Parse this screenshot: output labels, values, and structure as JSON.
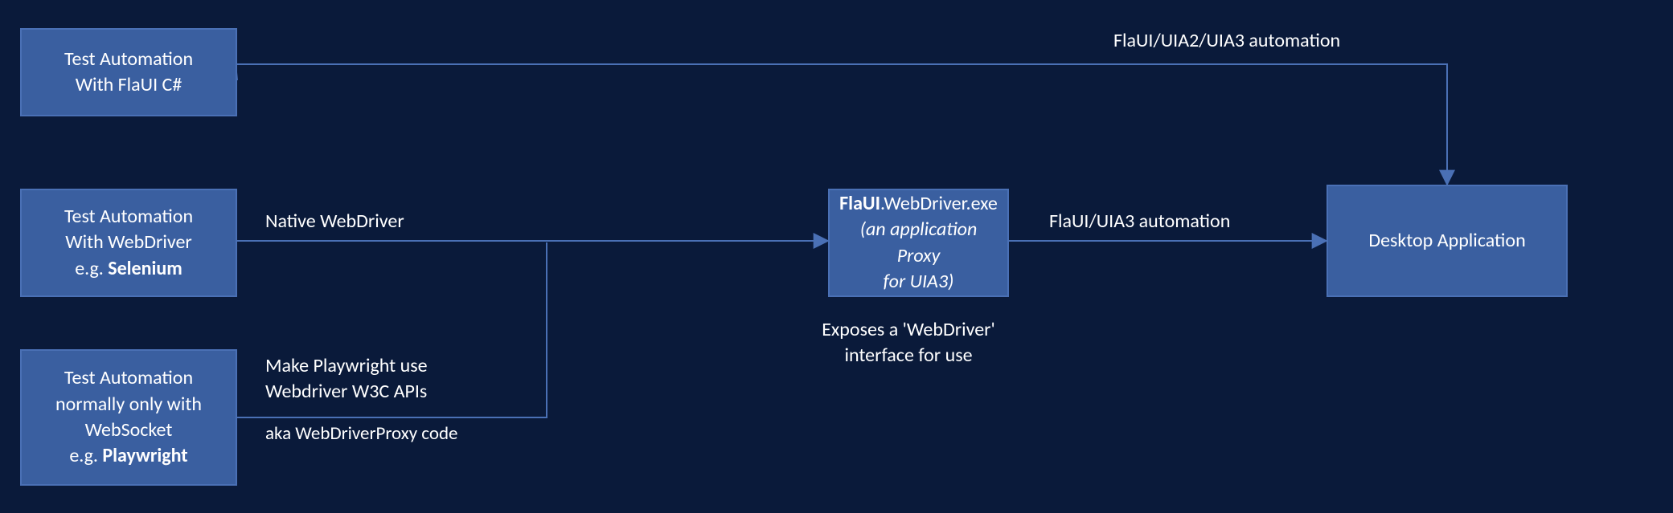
{
  "boxes": {
    "flaui_csharp": {
      "line1": "Test Automation",
      "line2": "With FlaUI C#"
    },
    "selenium": {
      "line1": "Test Automation",
      "line2": "With WebDriver",
      "line3_prefix": "e.g. ",
      "line3_bold": "Selenium"
    },
    "playwright": {
      "line1": "Test Automation",
      "line2": "normally only with",
      "line3": "WebSocket",
      "line4_prefix": "e.g. ",
      "line4_bold": "Playwright"
    },
    "proxy": {
      "line1_bold": "FlaUI",
      "line1_rest": ".WebDriver.exe",
      "line2": "(an application Proxy",
      "line3": "for UIA3)"
    },
    "desktop": {
      "text": "Desktop Application"
    }
  },
  "labels": {
    "top_edge": "FlaUI/UIA2/UIA3 automation",
    "native_wd": "Native WebDriver",
    "pw_line1": "Make Playwright use",
    "pw_line2": "Webdriver W3C APIs",
    "pw_sub": "aka  WebDriverProxy code",
    "exposes1": "Exposes a 'WebDriver'",
    "exposes2": "interface for use",
    "right_edge": "FlaUI/UIA3 automation"
  }
}
